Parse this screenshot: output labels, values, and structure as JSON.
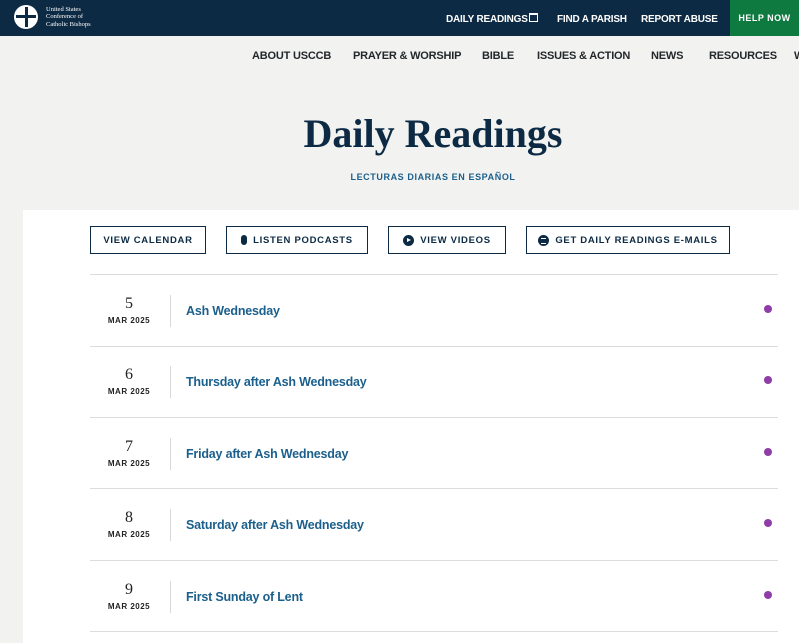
{
  "topbar": {
    "logo_text": "United States Conference of Catholic Bishops",
    "links": [
      "DAILY READINGS",
      "FIND A PARISH",
      "REPORT ABUSE"
    ],
    "help_label": "HELP NOW"
  },
  "nav": [
    "ABOUT USCCB",
    "PRAYER & WORSHIP",
    "BIBLE",
    "ISSUES & ACTION",
    "NEWS",
    "RESOURCES",
    "W"
  ],
  "header": {
    "title": "Daily Readings",
    "spanish_link": "LECTURAS DIARIAS EN ESPAÑOL"
  },
  "buttons": {
    "calendar": "VIEW CALENDAR",
    "podcasts": "LISTEN PODCASTS",
    "videos": "VIEW VIDEOS",
    "emails": "GET DAILY READINGS E-MAILS"
  },
  "readings": [
    {
      "day": "5",
      "month": "MAR 2025",
      "title": "Ash Wednesday",
      "color": "#8e3ea6"
    },
    {
      "day": "6",
      "month": "MAR 2025",
      "title": "Thursday after Ash Wednesday",
      "color": "#8e3ea6"
    },
    {
      "day": "7",
      "month": "MAR 2025",
      "title": "Friday after Ash Wednesday",
      "color": "#8e3ea6"
    },
    {
      "day": "8",
      "month": "MAR 2025",
      "title": "Saturday after Ash Wednesday",
      "color": "#8e3ea6"
    },
    {
      "day": "9",
      "month": "MAR 2025",
      "title": "First Sunday of Lent",
      "color": "#8e3ea6"
    }
  ]
}
